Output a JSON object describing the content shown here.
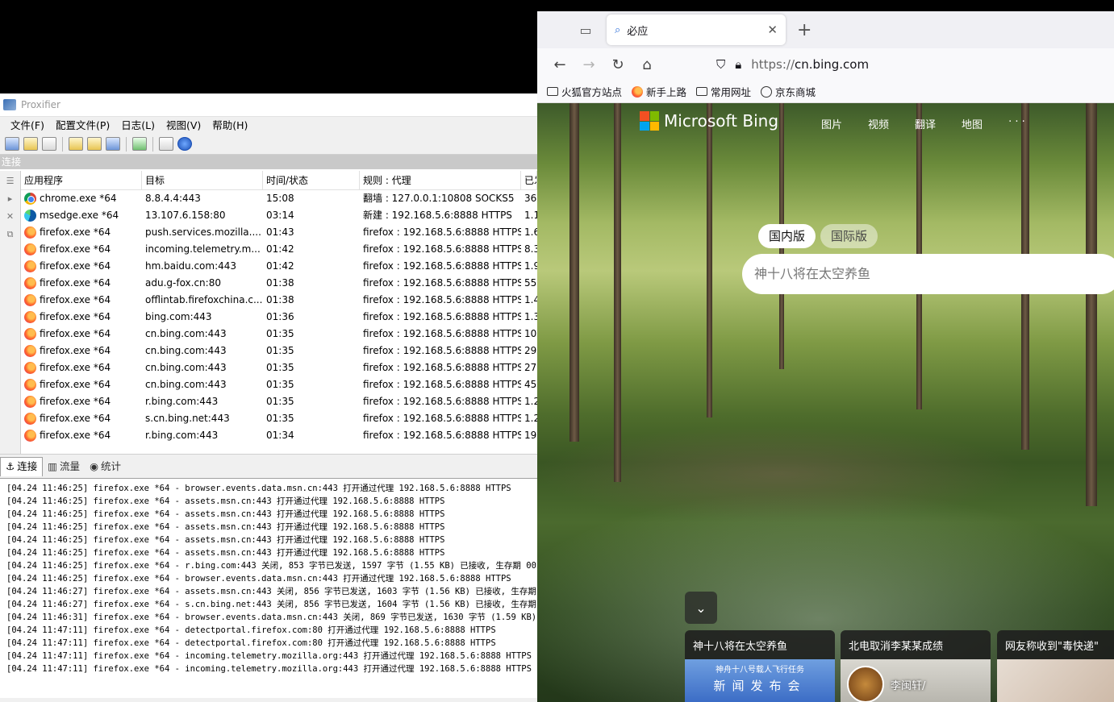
{
  "proxifier": {
    "title": "Proxifier",
    "menu": [
      "文件(F)",
      "配置文件(P)",
      "日志(L)",
      "视图(V)",
      "帮助(H)"
    ],
    "section_label": "连接",
    "columns": [
      "应用程序",
      "目标",
      "时间/状态",
      "规则 : 代理",
      "已发"
    ],
    "rows": [
      {
        "icon": "chrome",
        "app": "chrome.exe *64",
        "target": "8.8.4.4:443",
        "time": "15:08",
        "rule": "翻墙 : 127.0.0.1:10808 SOCKS5",
        "sent": "36"
      },
      {
        "icon": "edge",
        "app": "msedge.exe *64",
        "target": "13.107.6.158:80",
        "time": "03:14",
        "rule": "新建 : 192.168.5.6:8888 HTTPS",
        "sent": "1.1"
      },
      {
        "icon": "firefox",
        "app": "firefox.exe *64",
        "target": "push.services.mozilla....",
        "time": "01:43",
        "rule": "firefox : 192.168.5.6:8888 HTTPS",
        "sent": "1.6"
      },
      {
        "icon": "firefox",
        "app": "firefox.exe *64",
        "target": "incoming.telemetry.m...",
        "time": "01:42",
        "rule": "firefox : 192.168.5.6:8888 HTTPS",
        "sent": "8.3"
      },
      {
        "icon": "firefox",
        "app": "firefox.exe *64",
        "target": "hm.baidu.com:443",
        "time": "01:42",
        "rule": "firefox : 192.168.5.6:8888 HTTPS",
        "sent": "1.9"
      },
      {
        "icon": "firefox",
        "app": "firefox.exe *64",
        "target": "adu.g-fox.cn:80",
        "time": "01:38",
        "rule": "firefox : 192.168.5.6:8888 HTTPS",
        "sent": "55"
      },
      {
        "icon": "firefox",
        "app": "firefox.exe *64",
        "target": "offlintab.firefoxchina.c...",
        "time": "01:38",
        "rule": "firefox : 192.168.5.6:8888 HTTPS",
        "sent": "1.4"
      },
      {
        "icon": "firefox",
        "app": "firefox.exe *64",
        "target": "bing.com:443",
        "time": "01:36",
        "rule": "firefox : 192.168.5.6:8888 HTTPS",
        "sent": "1.3"
      },
      {
        "icon": "firefox",
        "app": "firefox.exe *64",
        "target": "cn.bing.com:443",
        "time": "01:35",
        "rule": "firefox : 192.168.5.6:8888 HTTPS",
        "sent": "10"
      },
      {
        "icon": "firefox",
        "app": "firefox.exe *64",
        "target": "cn.bing.com:443",
        "time": "01:35",
        "rule": "firefox : 192.168.5.6:8888 HTTPS",
        "sent": "29"
      },
      {
        "icon": "firefox",
        "app": "firefox.exe *64",
        "target": "cn.bing.com:443",
        "time": "01:35",
        "rule": "firefox : 192.168.5.6:8888 HTTPS",
        "sent": "27"
      },
      {
        "icon": "firefox",
        "app": "firefox.exe *64",
        "target": "cn.bing.com:443",
        "time": "01:35",
        "rule": "firefox : 192.168.5.6:8888 HTTPS",
        "sent": "45"
      },
      {
        "icon": "firefox",
        "app": "firefox.exe *64",
        "target": "r.bing.com:443",
        "time": "01:35",
        "rule": "firefox : 192.168.5.6:8888 HTTPS",
        "sent": "1.2"
      },
      {
        "icon": "firefox",
        "app": "firefox.exe *64",
        "target": "s.cn.bing.net:443",
        "time": "01:35",
        "rule": "firefox : 192.168.5.6:8888 HTTPS",
        "sent": "1.2"
      },
      {
        "icon": "firefox",
        "app": "firefox.exe *64",
        "target": "r.bing.com:443",
        "time": "01:34",
        "rule": "firefox : 192.168.5.6:8888 HTTPS",
        "sent": "19"
      }
    ],
    "tabs": [
      "连接",
      "流量",
      "统计"
    ],
    "log": [
      "[04.24 11:46:25] firefox.exe *64 - browser.events.data.msn.cn:443 打开通过代理 192.168.5.6:8888 HTTPS",
      "[04.24 11:46:25] firefox.exe *64 - assets.msn.cn:443 打开通过代理 192.168.5.6:8888 HTTPS",
      "[04.24 11:46:25] firefox.exe *64 - assets.msn.cn:443 打开通过代理 192.168.5.6:8888 HTTPS",
      "[04.24 11:46:25] firefox.exe *64 - assets.msn.cn:443 打开通过代理 192.168.5.6:8888 HTTPS",
      "[04.24 11:46:25] firefox.exe *64 - assets.msn.cn:443 打开通过代理 192.168.5.6:8888 HTTPS",
      "[04.24 11:46:25] firefox.exe *64 - assets.msn.cn:443 打开通过代理 192.168.5.6:8888 HTTPS",
      "[04.24 11:46:25] firefox.exe *64 - r.bing.com:443 关闭, 853 字节已发送, 1597 字节 (1.55 KB) 已接收, 生存期 00:",
      "[04.24 11:46:25] firefox.exe *64 - browser.events.data.msn.cn:443 打开通过代理 192.168.5.6:8888 HTTPS",
      "[04.24 11:46:27] firefox.exe *64 - assets.msn.cn:443 关闭, 856 字节已发送, 1603 字节 (1.56 KB) 已接收, 生存期",
      "[04.24 11:46:27] firefox.exe *64 - s.cn.bing.net:443 关闭, 856 字节已发送, 1604 字节 (1.56 KB) 已接收, 生存期",
      "[04.24 11:46:31] firefox.exe *64 - browser.events.data.msn.cn:443 关闭, 869 字节已发送, 1630 字节 (1.59 KB) 已",
      "[04.24 11:47:11] firefox.exe *64 - detectportal.firefox.com:80 打开通过代理 192.168.5.6:8888 HTTPS",
      "[04.24 11:47:11] firefox.exe *64 - detectportal.firefox.com:80 打开通过代理 192.168.5.6:8888 HTTPS",
      "[04.24 11:47:11] firefox.exe *64 - incoming.telemetry.mozilla.org:443 打开通过代理 192.168.5.6:8888 HTTPS",
      "[04.24 11:47:11] firefox.exe *64 - incoming.telemetry.mozilla.org:443 打开通过代理 192.168.5.6:8888 HTTPS"
    ]
  },
  "firefox": {
    "tab_title": "必应",
    "url_prefix": "https://",
    "url_host": "cn.bing.com",
    "bookmarks": [
      {
        "icon": "folder-icon",
        "label": "火狐官方站点"
      },
      {
        "icon": "firefox-icon",
        "label": "新手上路"
      },
      {
        "icon": "folder-icon",
        "label": "常用网址"
      },
      {
        "icon": "globe-icon",
        "label": "京东商城"
      }
    ]
  },
  "bing": {
    "brand": "Microsoft Bing",
    "nav": [
      "图片",
      "视频",
      "翻译",
      "地图",
      "· · ·"
    ],
    "tab_domestic": "国内版",
    "tab_international": "国际版",
    "search_placeholder": "神十八将在太空养鱼",
    "cards": [
      {
        "title": "神十八将在太空养鱼",
        "img_line1": "神舟十八号载人飞行任务",
        "img_line2": "新闻发布会"
      },
      {
        "title": "北电取消李某某成绩",
        "img_name": "李闽轩/"
      },
      {
        "title": "网友称收到\"毒快递\""
      }
    ]
  }
}
